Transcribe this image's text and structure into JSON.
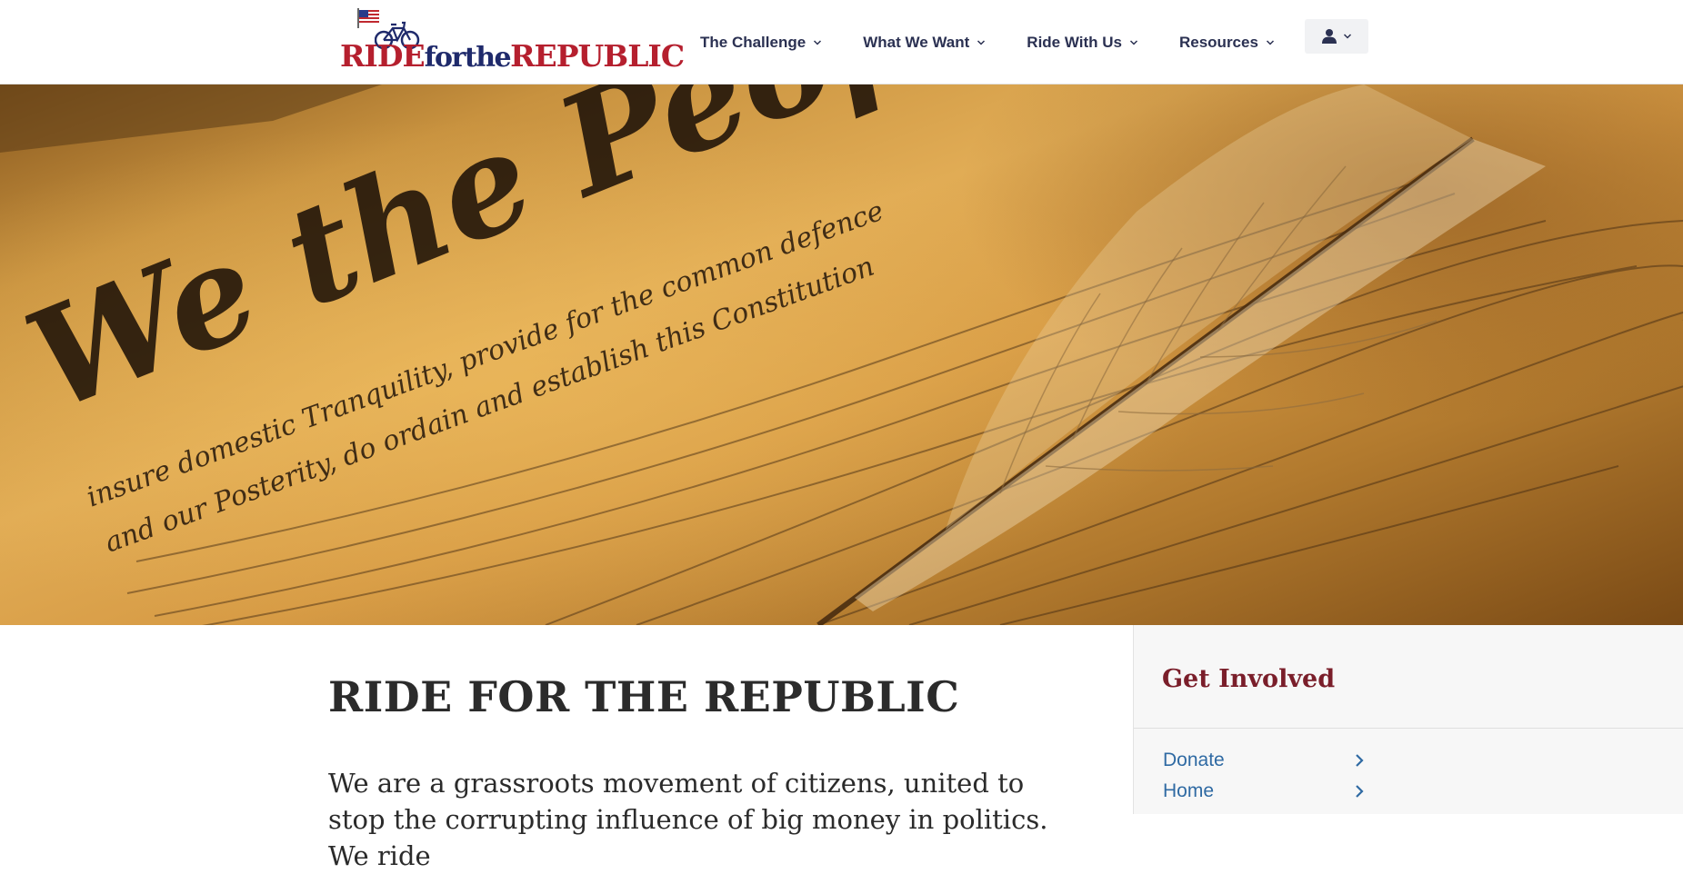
{
  "brand": {
    "logo_part1": "RIDE",
    "logo_part2": "forthe",
    "logo_part3": "REPUBLIC",
    "colors": {
      "red": "#b51f2e",
      "navy": "#1f2a6b"
    }
  },
  "nav": {
    "items": [
      {
        "label": "The Challenge",
        "icon": "chevron-down-icon"
      },
      {
        "label": "What We Want",
        "icon": "chevron-down-icon"
      },
      {
        "label": "Ride With Us",
        "icon": "chevron-down-icon"
      },
      {
        "label": "Resources",
        "icon": "chevron-down-icon"
      }
    ],
    "user_menu_icon": "user-icon"
  },
  "hero": {
    "headline_script": "We the People",
    "script_line1": "insure domestic Tranquility, provide for the common defence",
    "script_line2": "and our Posterity, do ordain and establish this Constitution"
  },
  "main": {
    "title": "RIDE FOR THE REPUBLIC",
    "intro": "We are a grassroots movement of citizens, united to stop the corrupting influence of big money in politics. We ride"
  },
  "sidebar": {
    "title": "Get Involved",
    "links": [
      {
        "label": "Donate",
        "icon": "chevron-right-icon"
      },
      {
        "label": "Home",
        "icon": "chevron-right-icon"
      }
    ]
  }
}
